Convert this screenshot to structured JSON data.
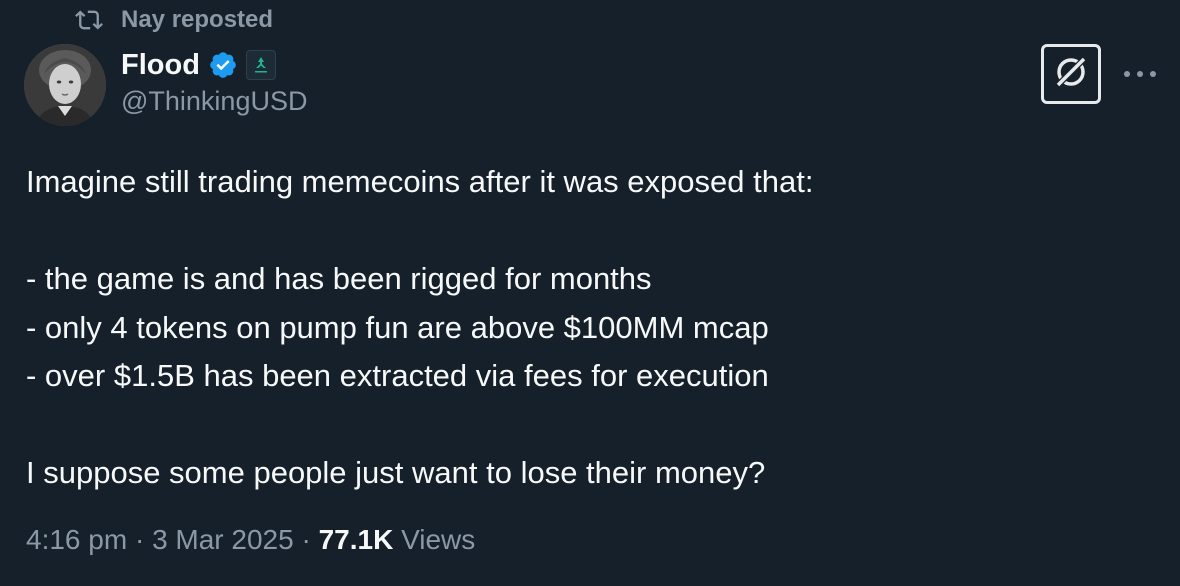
{
  "repost": {
    "text": "Nay reposted",
    "icon": "repost-icon"
  },
  "author": {
    "display_name": "Flood",
    "handle": "@ThinkingUSD",
    "verified_color": "#1d9bf0",
    "affiliate_color": "#1fb58f"
  },
  "actions": {
    "grok_icon": "grok-icon",
    "more_icon": "more-dots-icon"
  },
  "tweet": {
    "lines": [
      "Imagine still trading memecoins after it was exposed that:",
      "",
      "- the game is and has been rigged for months",
      "- only 4 tokens on pump fun are above $100MM mcap",
      "- over $1.5B has been extracted via fees for execution",
      "",
      "I suppose some people just want to lose their money?"
    ]
  },
  "meta": {
    "time": "4:16 pm",
    "separator": " · ",
    "date": "3 Mar 2025",
    "views_count": "77.1K",
    "views_label": "Views"
  }
}
